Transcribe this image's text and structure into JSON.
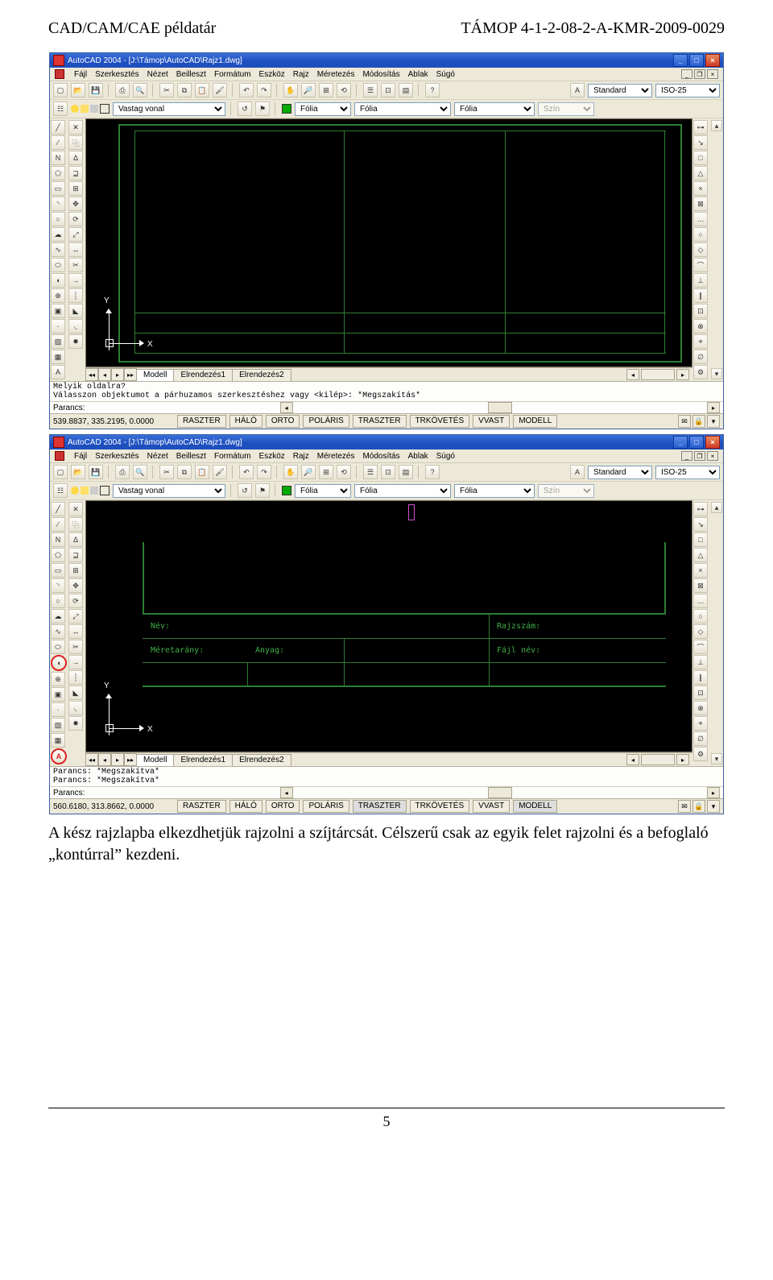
{
  "doc": {
    "header_left": "CAD/CAM/CAE példatár",
    "header_right": "TÁMOP 4-1-2-08-2-A-KMR-2009-0029",
    "caption": "A kész rajzlapba elkezdhetjük rajzolni a szíjtárcsát. Célszerű csak az egyik felet rajzolni és a befoglaló „kontúrral” kezdeni.",
    "page_number": "5"
  },
  "menus": [
    "Fájl",
    "Szerkesztés",
    "Nézet",
    "Beilleszt",
    "Formátum",
    "Eszköz",
    "Rajz",
    "Méretezés",
    "Módosítás",
    "Ablak",
    "Súgó"
  ],
  "status_buttons": [
    "RASZTER",
    "HÁLÓ",
    "ORTO",
    "POLÁRIS",
    "TRASZTER",
    "TRKÖVETÉS",
    "VVAST",
    "MODELL"
  ],
  "tabs": {
    "nav": [
      "◂◂",
      "◂",
      "▸",
      "▸▸"
    ],
    "model": "Modell",
    "layouts_a": [
      "Elrendezés1",
      "Elrendezés2"
    ],
    "layouts_b": [
      "Elrendezés1",
      "Elrendezés2"
    ]
  },
  "toolbar": {
    "style_select": "Standard",
    "dimstyle_select": "ISO-25",
    "layer_name": "Vastag vonal",
    "linetype": "Fólia",
    "lineweight": "Fólia",
    "color_label": "Fólia",
    "plotstyle": "Szín"
  },
  "ucs": {
    "x": "X",
    "y": "Y"
  },
  "win1": {
    "title": "AutoCAD 2004 - [J:\\Támop\\AutoCAD\\Rajz1.dwg]",
    "cmd1": "Melyik oldalra?",
    "cmd2": "Válasszon objektumot a párhuzamos szerkesztéshez vagy <kilép>: *Megszakítás*",
    "cmd3": "Parancs:",
    "coords": "539.8837, 335.2195, 0.0000"
  },
  "win2": {
    "title": "AutoCAD 2004 - [J:\\Támop\\AutoCAD\\Rajz1.dwg]",
    "tb_labels": {
      "nev": "Név:",
      "rajzszam": "Rajzszám:",
      "meretarany": "Méretarány:",
      "anyag": "Anyag:",
      "fajlnev": "Fájl név:"
    },
    "cmd1": "Parancs: *Megszakítva*",
    "cmd2": "Parancs: *Megszakítva*",
    "cmd3": "Parancs:",
    "coords": "560.6180, 313.8662, 0.0000"
  }
}
